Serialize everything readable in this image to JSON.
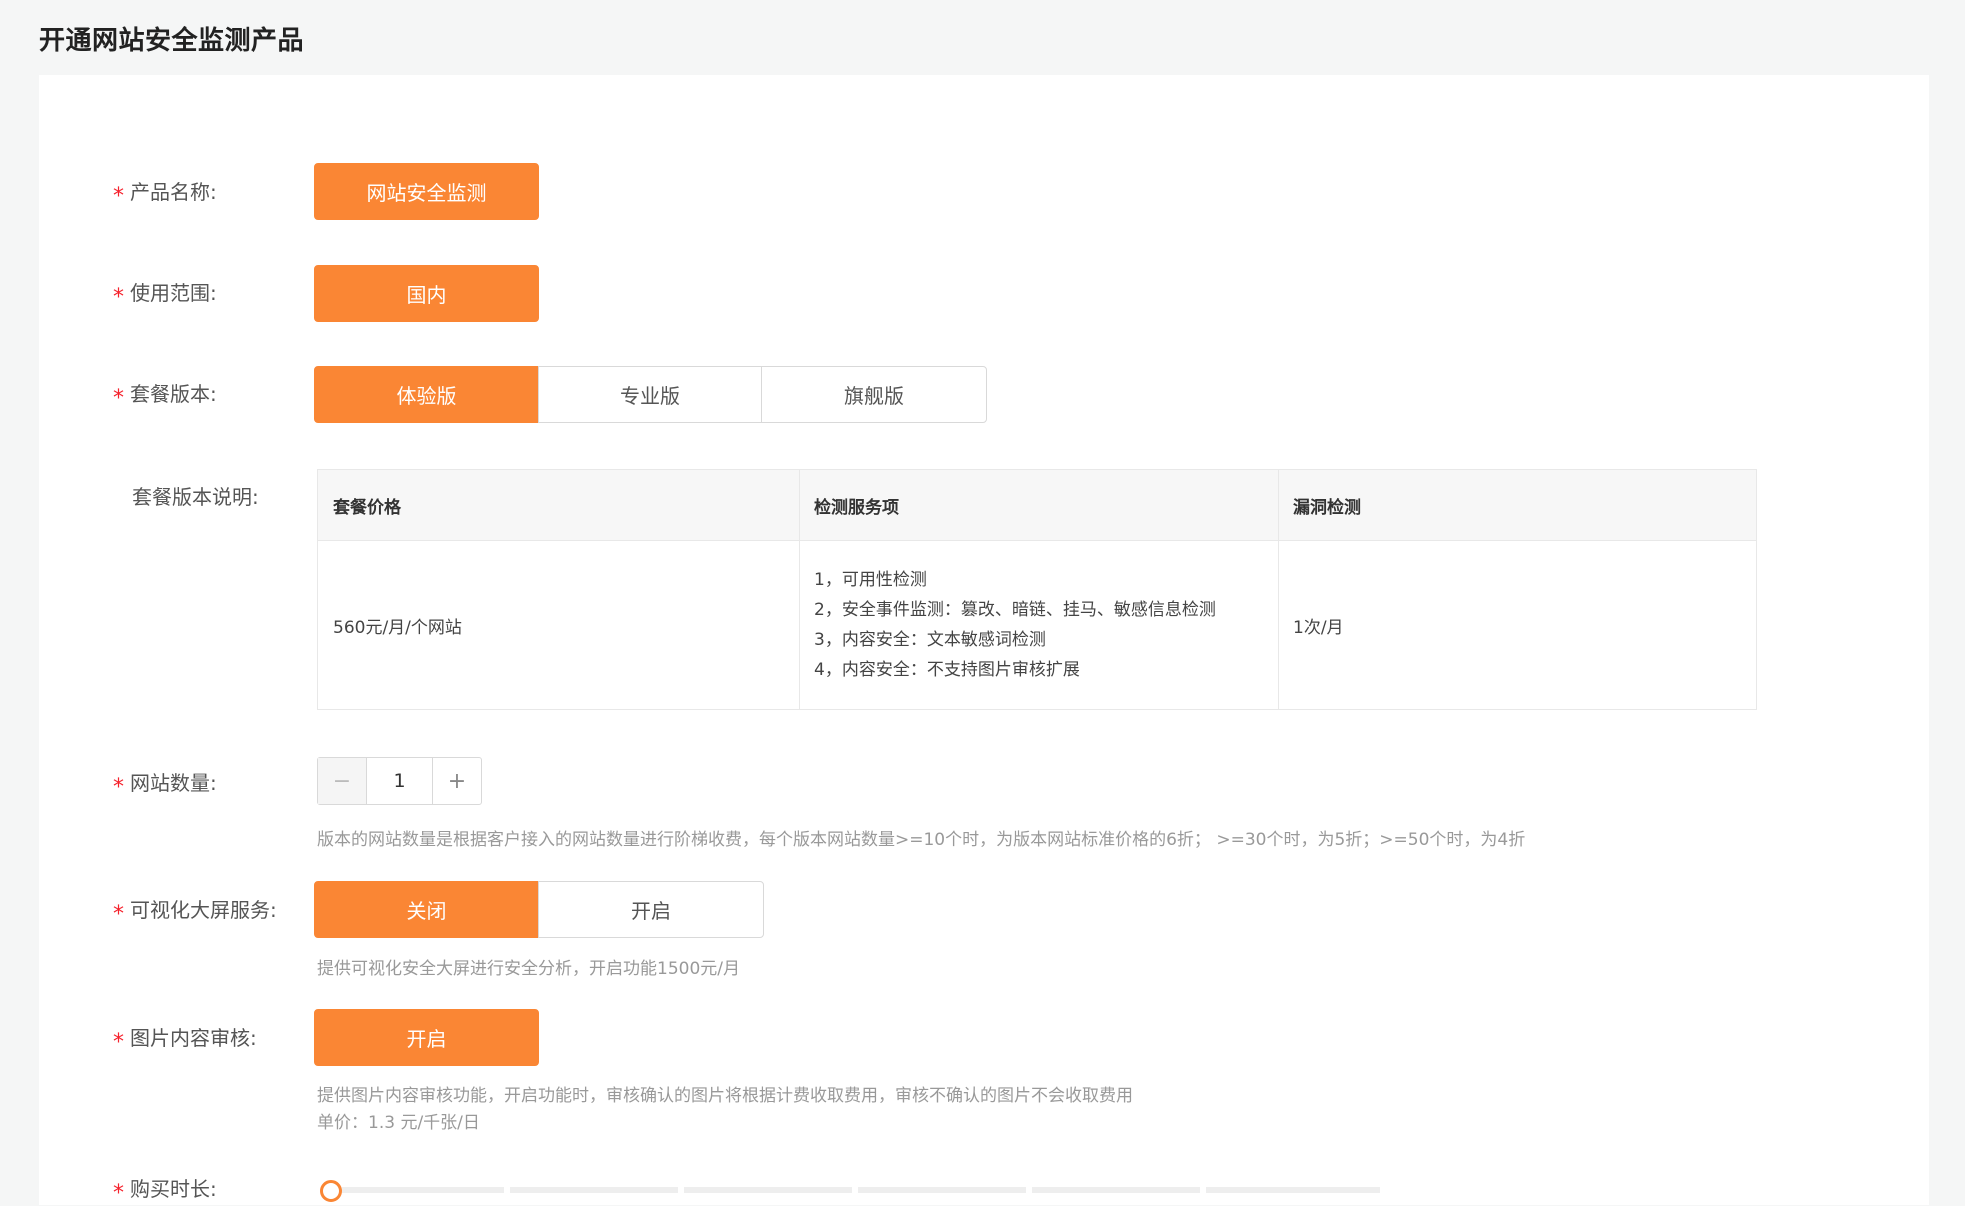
{
  "page": {
    "title": "开通网站安全监测产品"
  },
  "form": {
    "product_name": {
      "label": "产品名称:",
      "value": "网站安全监测"
    },
    "scope": {
      "label": "使用范围:",
      "value": "国内"
    },
    "plan": {
      "label": "套餐版本:",
      "options": [
        "体验版",
        "专业版",
        "旗舰版"
      ],
      "selected": "体验版"
    },
    "plan_desc": {
      "label": "套餐版本说明:",
      "headers": [
        "套餐价格",
        "检测服务项",
        "漏洞检测"
      ],
      "price": "560元/月/个网站",
      "services": [
        "1，可用性检测",
        "2，安全事件监测：篡改、暗链、挂马、敏感信息检测",
        "3，内容安全：文本敏感词检测",
        "4，内容安全：不支持图片审核扩展"
      ],
      "vuln": "1次/月"
    },
    "site_count": {
      "label": "网站数量:",
      "value": "1",
      "minus": "−",
      "plus": "+",
      "hint": "版本的网站数量是根据客户接入的网站数量进行阶梯收费，每个版本网站数量>=10个时，为版本网站标准价格的6折； >=30个时，为5折；>=50个时，为4折"
    },
    "big_screen": {
      "label": "可视化大屏服务:",
      "options": [
        "关闭",
        "开启"
      ],
      "selected": "关闭",
      "hint": "提供可视化安全大屏进行安全分析，开启功能1500元/月"
    },
    "image_audit": {
      "label": "图片内容审核:",
      "value": "开启",
      "hint1": "提供图片内容审核功能，开启功能时，审核确认的图片将根据计费收取费用，审核不确认的图片不会收取费用",
      "hint2": "单价：1.3 元/千张/日"
    },
    "duration": {
      "label": "购买时长:"
    }
  },
  "colors": {
    "accent": "#fa8634",
    "required": "#f5222d"
  }
}
